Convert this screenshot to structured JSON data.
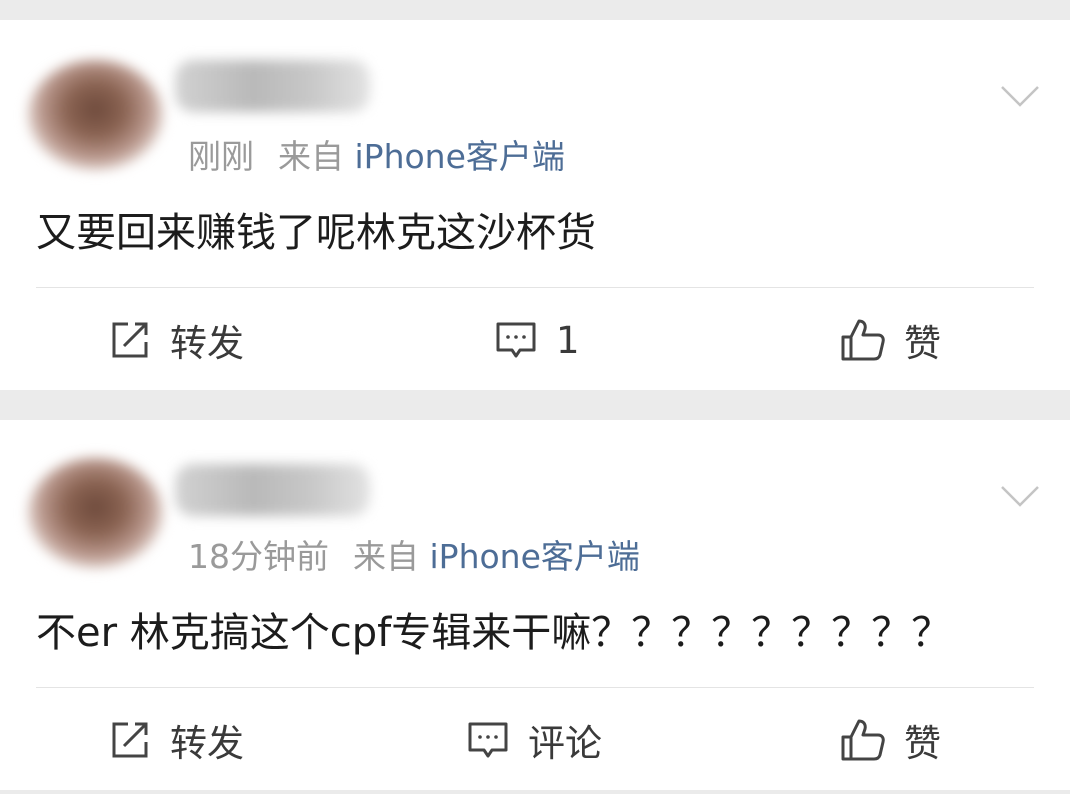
{
  "posts": [
    {
      "time": "刚刚",
      "source_prefix": "来自",
      "source": "iPhone客户端",
      "content": "又要回来赚钱了呢林克这沙杯货",
      "actions": {
        "forward": "转发",
        "comment": "1",
        "like": "赞"
      }
    },
    {
      "time": "18分钟前",
      "source_prefix": "来自",
      "source": "iPhone客户端",
      "content": "不er 林克搞这个cpf专辑来干嘛？？？？？？？？？",
      "actions": {
        "forward": "转发",
        "comment": "评论",
        "like": "赞"
      }
    }
  ],
  "colors": {
    "source_link": "#4d6d96",
    "background": "#ebebeb",
    "card": "#ffffff"
  },
  "icons": [
    "chevron-down-icon",
    "edit-share-icon",
    "comment-icon",
    "thumbs-up-icon"
  ]
}
